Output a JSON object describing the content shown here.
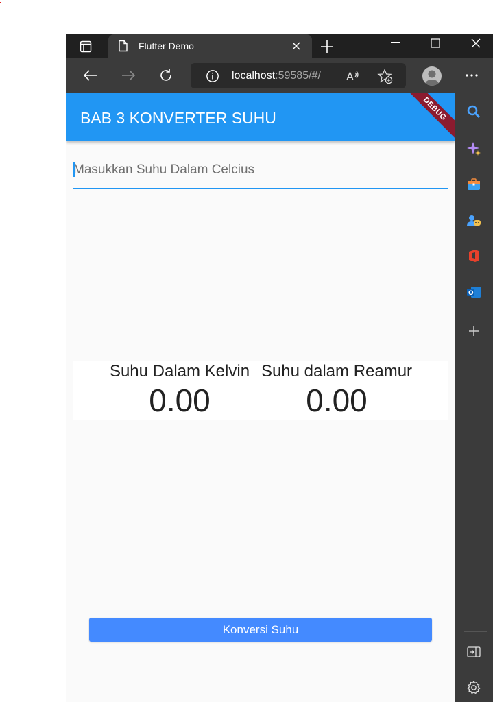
{
  "browser": {
    "tab_title": "Flutter Demo",
    "address_host": "localhost",
    "address_rest": ":59585/#/"
  },
  "app": {
    "title": "BAB 3 KONVERTER SUHU",
    "debug_banner": "DEBUG",
    "input": {
      "value": "",
      "placeholder": "Masukkan Suhu Dalam Celcius"
    },
    "results": [
      {
        "label": "Suhu Dalam Kelvin",
        "value": "0.00"
      },
      {
        "label": "Suhu dalam Reamur",
        "value": "0.00"
      }
    ],
    "convert_button": "Konversi Suhu"
  },
  "colors": {
    "appbar": "#2196f3",
    "button": "#448aff",
    "debug": "#8b1b2f",
    "chrome_dark": "#202020",
    "chrome_mid": "#3b3b3b"
  },
  "icons": {
    "sidebar": [
      "search-icon",
      "copilot-icon",
      "tools-icon",
      "games-icon",
      "office-icon",
      "outlook-icon",
      "add-icon",
      "split-screen-icon",
      "settings-icon"
    ]
  }
}
